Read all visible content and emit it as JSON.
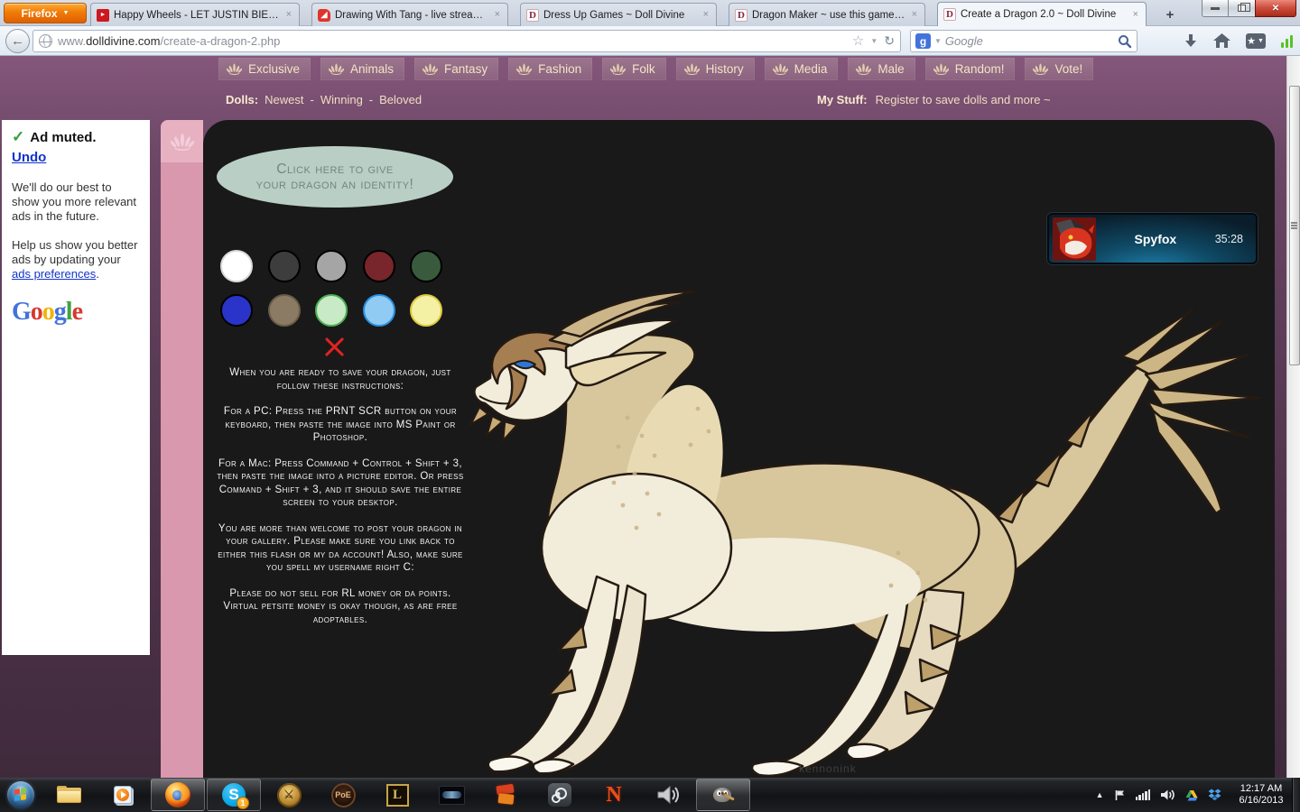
{
  "browser": {
    "firefox_button": "Firefox",
    "tabs": [
      {
        "title": "Happy Wheels - LET JUSTIN BIEBER...",
        "icon": "youtube"
      },
      {
        "title": "Drawing With Tang - live streamin...",
        "icon": "livestream"
      },
      {
        "title": "Dress Up Games ~ Doll Divine",
        "icon": "dolldivine"
      },
      {
        "title": "Dragon Maker ~ use this game to ...",
        "icon": "dolldivine"
      },
      {
        "title": "Create a Dragon 2.0 ~ Doll Divine",
        "icon": "dolldivine"
      }
    ],
    "tab_close": "×",
    "new_tab": "+",
    "url_prefix": "www.",
    "url_domain": "dolldivine.com",
    "url_path": "/create-a-dragon-2.php",
    "search_placeholder": "Google",
    "search_icon_letter": "g"
  },
  "site": {
    "nav": [
      "Exclusive",
      "Animals",
      "Fantasy",
      "Fashion",
      "Folk",
      "History",
      "Media",
      "Male",
      "Random!",
      "Vote!"
    ],
    "dolls_label": "Dolls:",
    "dolls_links": [
      "Newest",
      "Winning",
      "Beloved"
    ],
    "sep": "-",
    "mystuff_label": "My Stuff:",
    "mystuff_text": "Register to save dolls and more ~"
  },
  "ad": {
    "title": "Ad muted.",
    "undo": "Undo",
    "para1": "We'll do our best to show you more relevant ads in the future.",
    "para2_prefix": "Help us show you better ads by updating your ",
    "para2_link": "ads preferences",
    "para2_suffix": ".",
    "google_letters": [
      {
        "ch": "G",
        "color": "#4272db"
      },
      {
        "ch": "o",
        "color": "#d7382f"
      },
      {
        "ch": "o",
        "color": "#f0b400"
      },
      {
        "ch": "g",
        "color": "#4272db"
      },
      {
        "ch": "l",
        "color": "#3fa13f"
      },
      {
        "ch": "e",
        "color": "#d7382f"
      }
    ]
  },
  "flash": {
    "cta_line1": "Click here to give",
    "cta_line2": "your dragon an identity!",
    "swatches": [
      {
        "fill": "#ffffff",
        "ring": "#d8d8d8"
      },
      {
        "fill": "#3d3d3d",
        "ring": "#000000"
      },
      {
        "fill": "#a5a5a5",
        "ring": "#000000"
      },
      {
        "fill": "#78252b",
        "ring": "#000000"
      },
      {
        "fill": "#3a5a3e",
        "ring": "#000000"
      },
      {
        "fill": "#2a34c8",
        "ring": "#000000"
      },
      {
        "fill": "#8b7b64",
        "ring": "#6a5c48"
      },
      {
        "fill": "#c9eac6",
        "ring": "#4db052"
      },
      {
        "fill": "#8fcbf2",
        "ring": "#2a8fe0"
      },
      {
        "fill": "#f4f0a4",
        "ring": "#ddc83e"
      }
    ],
    "instructions": [
      "When you are ready to save your dragon, just follow these instructions:",
      "For a PC: Press the PRNT SCR button on your keyboard, then paste the image into MS Paint or Photoshop.",
      "For a Mac: Press Command + Control + Shift + 3, then paste the image into a picture editor.  Or press Command + Shift + 3, and it should save the entire screen to your desktop.",
      "You are more than welcome to post your dragon in your gallery.  Please make sure you link back to either this flash or my da account!  Also, make sure you spell my username right C:",
      "Please do not sell for RL money or da points.  Virtual petsite money is okay though, as are free adoptables."
    ],
    "watermark": "kennonink"
  },
  "spyfox": {
    "name": "Spyfox",
    "time": "35:28"
  },
  "taskbar": {
    "skype_badge": "1",
    "swtor_label": "⚔",
    "poe_label": "PoE",
    "lol_label": "L",
    "n_label": "N",
    "skype_letter": "S",
    "clock_time": "12:17 AM",
    "clock_date": "6/16/2013"
  }
}
